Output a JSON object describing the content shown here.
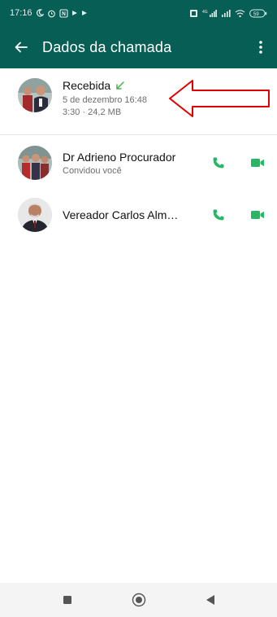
{
  "status_bar": {
    "time": "17:16",
    "battery": "59",
    "network": "4G"
  },
  "app_bar": {
    "title": "Dados da chamada"
  },
  "call": {
    "type": "Recebida",
    "date": "5 de dezembro 16:48",
    "duration_size": "3:30 · 24,2 MB"
  },
  "participants": [
    {
      "name": "Dr Adrieno Procurador",
      "status": "Convidou você"
    },
    {
      "name": "Vereador Carlos Alm…",
      "status": ""
    }
  ],
  "colors": {
    "header": "#075e54",
    "accent": "#25d366",
    "received_arrow": "#4caf50",
    "annotation": "#e00000"
  },
  "icons": {
    "back": "arrow-left-icon",
    "menu": "more-vert-icon",
    "call": "phone-icon",
    "video": "video-camera-icon",
    "received": "call-received-icon"
  }
}
